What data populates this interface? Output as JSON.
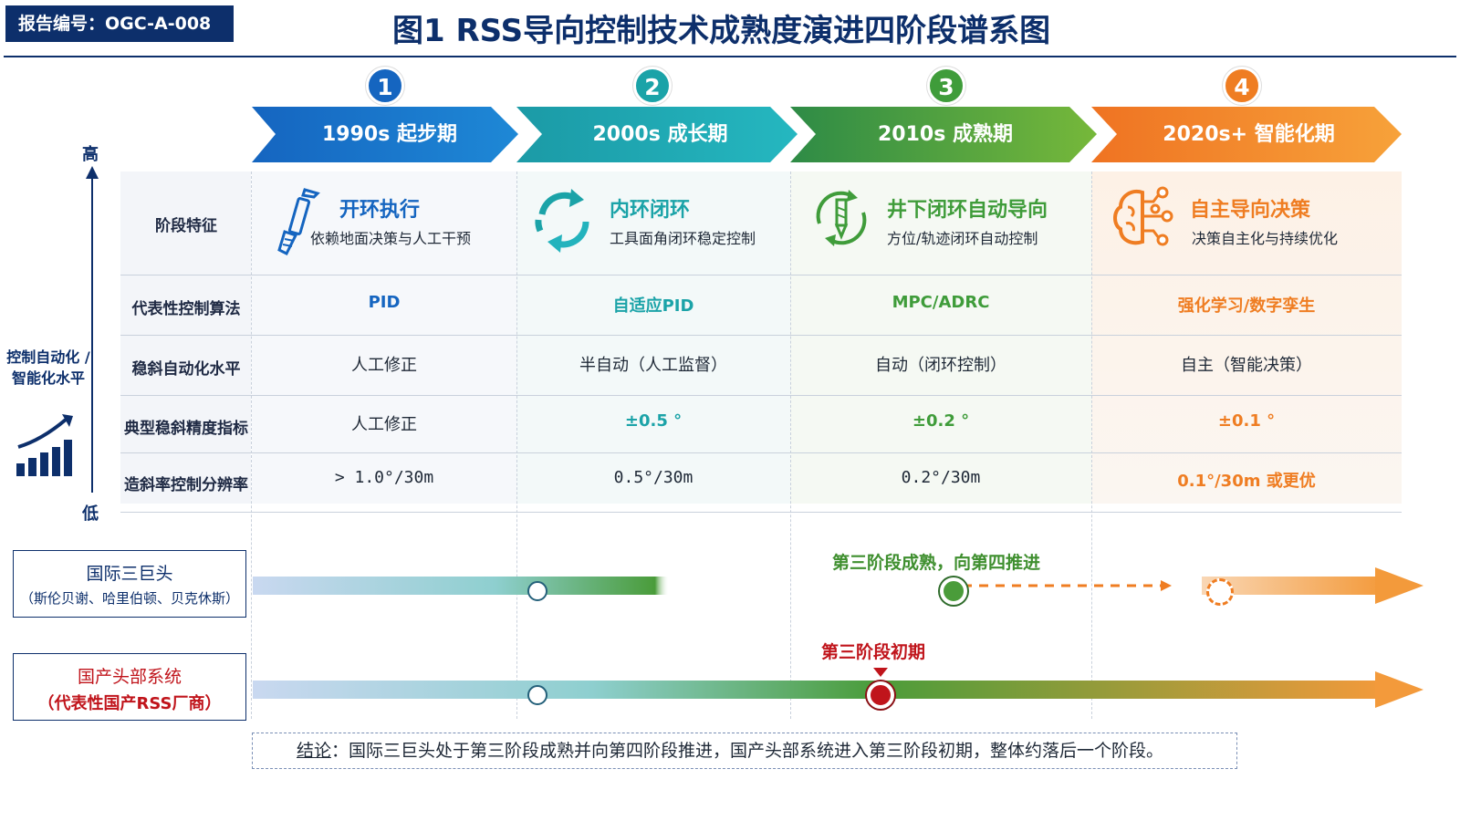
{
  "report_id": "报告编号：OGC-A-008",
  "title": "图1  RSS导向控制技术成熟度演进四阶段谱系图",
  "y_axis": {
    "high": "高",
    "low": "低",
    "label": "控制自动化 / 智能化水平"
  },
  "stages": [
    {
      "num": "1",
      "label": "1990s 起步期",
      "color": "#1f6fc8"
    },
    {
      "num": "2",
      "label": "2000s 成长期",
      "color": "#1ba3a8"
    },
    {
      "num": "3",
      "label": "2010s 成熟期",
      "color": "#4a9c3a"
    },
    {
      "num": "4",
      "label": "2020s+ 智能化期",
      "color": "#ef7d22"
    }
  ],
  "row_headers": [
    "阶段特征",
    "代表性控制算法",
    "稳斜自动化水平",
    "典型稳斜精度指标",
    "造斜率控制分辨率"
  ],
  "features": [
    {
      "title": "开环执行",
      "sub": "依赖地面决策与人工干预",
      "icon": "drill-bit-icon"
    },
    {
      "title": "内环闭环",
      "sub": "工具面角闭环稳定控制",
      "icon": "cycle-arrows-icon"
    },
    {
      "title": "井下闭环自动导向",
      "sub": "方位/轨迹闭环自动控制",
      "icon": "drill-cycle-icon"
    },
    {
      "title": "自主导向决策",
      "sub": "决策自主化与持续优化",
      "icon": "brain-circuit-icon"
    }
  ],
  "algorithms": [
    "PID",
    "自适应PID",
    "MPC/ADRC",
    "强化学习/数字孪生"
  ],
  "automation": [
    "人工修正",
    "半自动（人工监督）",
    "自动（闭环控制）",
    "自主（智能决策）"
  ],
  "precision": [
    "人工修正",
    "±0.5 °",
    "±0.2 °",
    "±0.1 °"
  ],
  "resolution": [
    "> 1.0°/30m",
    "0.5°/30m",
    "0.2°/30m",
    "0.1°/30m 或更优"
  ],
  "tracks": [
    {
      "name": "国际三巨头",
      "sub": "（斯伦贝谢、哈里伯顿、贝克休斯）",
      "status": "第三阶段成熟，向第四推进",
      "status_color": "#3f8f2f"
    },
    {
      "name": "国产头部系统",
      "sub": "（代表性国产RSS厂商）",
      "status": "第三阶段初期",
      "status_color": "#c0141b"
    }
  ],
  "conclusion": {
    "key": "结论",
    "text": "：国际三巨头处于第三阶段成熟并向第四阶段推进，国产头部系统进入第三阶段初期，整体约落后一个阶段。"
  }
}
